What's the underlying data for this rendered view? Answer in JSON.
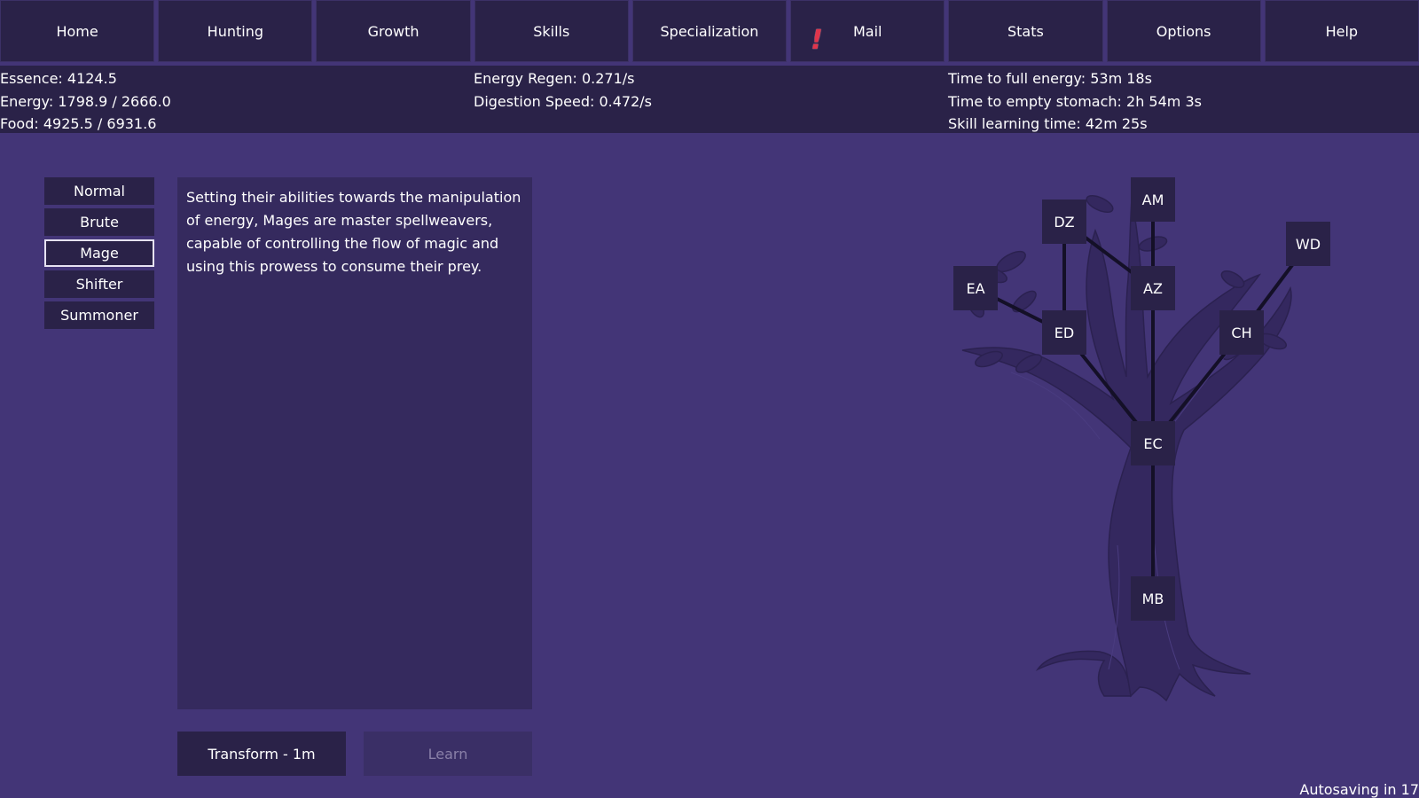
{
  "nav": {
    "items": [
      "Home",
      "Hunting",
      "Growth",
      "Skills",
      "Specialization",
      "Mail",
      "Stats",
      "Options",
      "Help"
    ],
    "mail_alert": "!"
  },
  "stats": {
    "essence": "Essence: 4124.5",
    "energy": "Energy: 1798.9 / 2666.0",
    "food": "Food: 4925.5 / 6931.6",
    "energy_regen": "Energy Regen: 0.271/s",
    "digestion_speed": "Digestion Speed: 0.472/s",
    "time_full_energy": "Time to full energy: 53m 18s",
    "time_empty_stomach": "Time to empty stomach: 2h 54m 3s",
    "skill_learning_time": "Skill learning time: 42m 25s"
  },
  "specializations": {
    "items": [
      "Normal",
      "Brute",
      "Mage",
      "Shifter",
      "Summoner"
    ],
    "selected": "Mage"
  },
  "description": "Setting their abilities towards the manipulation of energy, Mages are master spellweavers, capable of controlling the flow of magic and using this prowess to consume their prey.",
  "actions": {
    "transform": "Transform - 1m",
    "learn": "Learn"
  },
  "skill_tree": {
    "nodes": [
      "AM",
      "DZ",
      "WD",
      "EA",
      "AZ",
      "ED",
      "CH",
      "EC",
      "MB"
    ],
    "links": [
      [
        "MB",
        "EC"
      ],
      [
        "EC",
        "ED"
      ],
      [
        "EC",
        "CH"
      ],
      [
        "EC",
        "AZ"
      ],
      [
        "ED",
        "EA"
      ],
      [
        "ED",
        "DZ"
      ],
      [
        "DZ",
        "AZ"
      ],
      [
        "AZ",
        "AM"
      ],
      [
        "CH",
        "WD"
      ]
    ]
  },
  "footer": {
    "autosave": "Autosaving in 17"
  },
  "colors": {
    "background": "#433577",
    "panel": "#2a2248",
    "description_panel": "#352a5e",
    "alert": "#e0344b",
    "tree_silhouette": "#34285f"
  }
}
